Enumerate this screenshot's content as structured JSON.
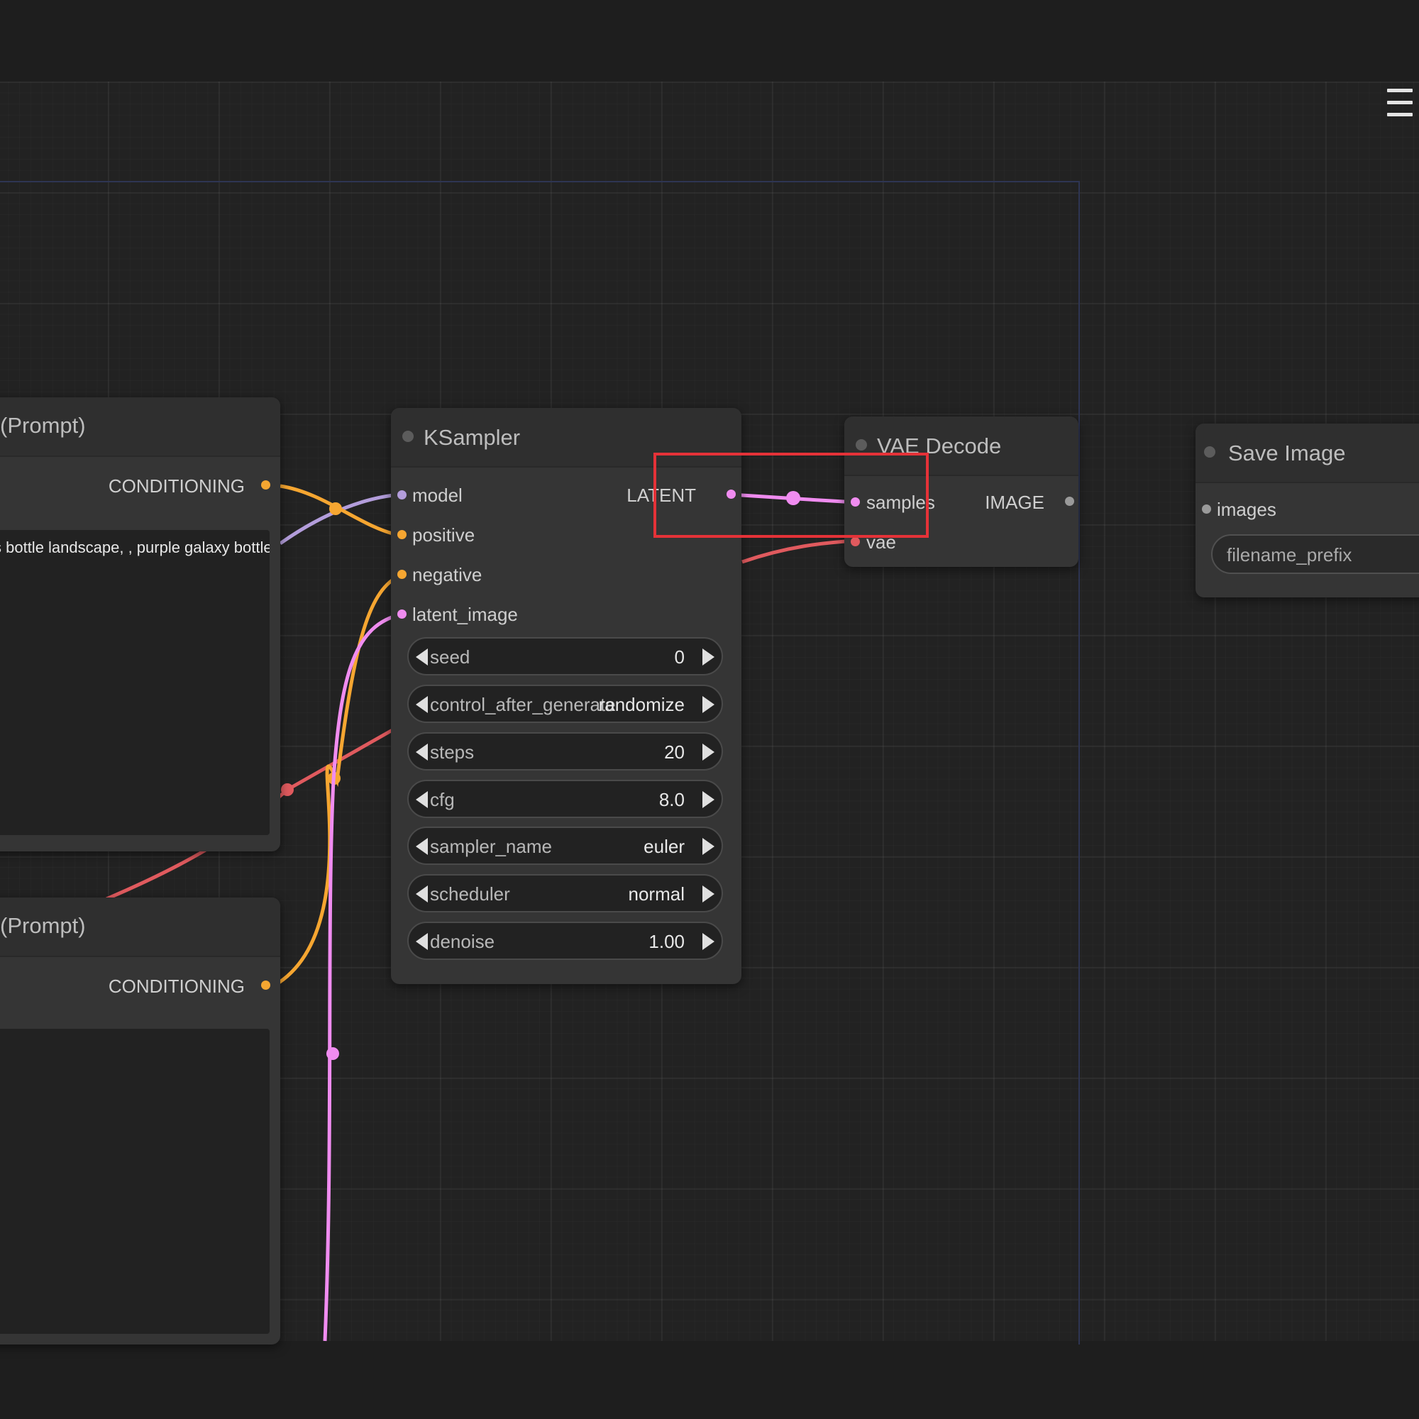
{
  "colors": {
    "conditioning": "#f6a631",
    "latent": "#f08cf0",
    "model": "#b39ddb",
    "vae": "#e05a5e",
    "image": "#9a9a9a",
    "highlight": "#e53238"
  },
  "menu": {
    "icon": "hamburger-menu-icon"
  },
  "prompt_node_1": {
    "title": "(Prompt)",
    "output_label": "CONDITIONING",
    "text": "ss bottle landscape, , purple galaxy bottle,"
  },
  "prompt_node_2": {
    "title": "(Prompt)",
    "output_label": "CONDITIONING",
    "text": ""
  },
  "ksampler": {
    "title": "KSampler",
    "inputs": [
      "model",
      "positive",
      "negative",
      "latent_image"
    ],
    "output_label": "LATENT",
    "widgets": [
      {
        "name": "seed",
        "value": "0"
      },
      {
        "name": "control_after_generate",
        "value": "randomize"
      },
      {
        "name": "steps",
        "value": "20"
      },
      {
        "name": "cfg",
        "value": "8.0"
      },
      {
        "name": "sampler_name",
        "value": "euler"
      },
      {
        "name": "scheduler",
        "value": "normal"
      },
      {
        "name": "denoise",
        "value": "1.00"
      }
    ]
  },
  "vae_decode": {
    "title": "VAE Decode",
    "inputs": [
      "samples",
      "vae"
    ],
    "output_label": "IMAGE"
  },
  "save_image": {
    "title": "Save Image",
    "inputs": [
      "images"
    ],
    "widget_label": "filename_prefix"
  }
}
